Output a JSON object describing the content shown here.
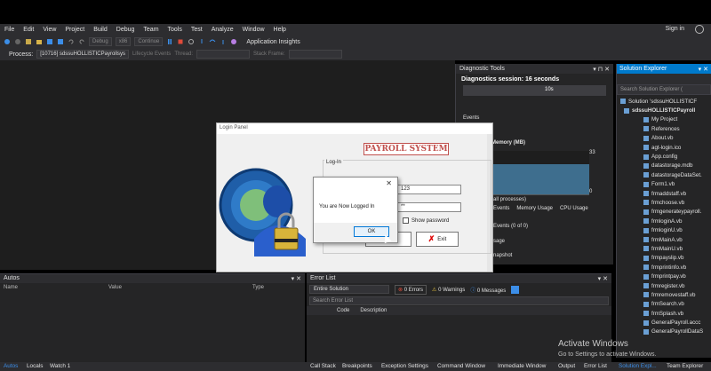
{
  "menu": [
    "File",
    "Edit",
    "View",
    "Project",
    "Build",
    "Debug",
    "Team",
    "Tools",
    "Test",
    "Analyze",
    "Window",
    "Help"
  ],
  "sign_in": "Sign in",
  "toolbar": {
    "config": "Debug",
    "platform": "x86",
    "continue": "Continue",
    "app_insights": "Application Insights"
  },
  "procbar": {
    "label": "Process:",
    "process": "[10716] sdssuHOLLISTICPayrollsys",
    "lifecycle": "Lifecycle Events",
    "thread": "Thread:",
    "stack": "Stack Frame:"
  },
  "diag": {
    "title": "Diagnostic Tools",
    "session": "Diagnostics session: 16 seconds",
    "timeline_label": "10s",
    "events": "Events",
    "memory": "Memory (MB)",
    "max": "33",
    "min": "0",
    "all_processes": "all processes)",
    "tabs": [
      "Events",
      "Memory Usage",
      "CPU Usage"
    ],
    "events_count": "Events (0 of 0)",
    "usage": "sage",
    "snapshot": "napshot"
  },
  "solution_explorer": {
    "title": "Solution Explorer",
    "search": "Search Solution Explorer (",
    "items": [
      {
        "label": "Solution 'sdssuHOLLISTICF",
        "bold": false
      },
      {
        "label": "sdssuHOLLISTICPayroll",
        "bold": true
      },
      {
        "label": "My Project",
        "bold": false
      },
      {
        "label": "References",
        "bold": false
      },
      {
        "label": "About.vb",
        "bold": false
      },
      {
        "label": "agt-login.ico",
        "bold": false
      },
      {
        "label": "App.config",
        "bold": false
      },
      {
        "label": "datastorage.mdb",
        "bold": false
      },
      {
        "label": "datastorageDataSet.",
        "bold": false
      },
      {
        "label": "Form1.vb",
        "bold": false
      },
      {
        "label": "frmaddstaff.vb",
        "bold": false
      },
      {
        "label": "frmchoose.vb",
        "bold": false
      },
      {
        "label": "frmgenerateypayroll.",
        "bold": false
      },
      {
        "label": "frmloginA.vb",
        "bold": false
      },
      {
        "label": "frmloginU.vb",
        "bold": false
      },
      {
        "label": "frmMainA.vb",
        "bold": false
      },
      {
        "label": "frmMainU.vb",
        "bold": false
      },
      {
        "label": "frmpayslip.vb",
        "bold": false
      },
      {
        "label": "frmprintinfo.vb",
        "bold": false
      },
      {
        "label": "frmprintpay.vb",
        "bold": false
      },
      {
        "label": "frmregister.vb",
        "bold": false
      },
      {
        "label": "frmremovestaff.vb",
        "bold": false
      },
      {
        "label": "frmSearch.vb",
        "bold": false
      },
      {
        "label": "frmSplash.vb",
        "bold": false
      },
      {
        "label": "GeneralPayroll.accc",
        "bold": false
      },
      {
        "label": "GeneralPayrollDataS",
        "bold": false
      }
    ]
  },
  "autos": {
    "title": "Autos",
    "cols": [
      "Name",
      "Value",
      "Type"
    ]
  },
  "errors": {
    "title": "Error List",
    "scope": "Entire Solution",
    "errors": "0 Errors",
    "warnings": "0 Warnings",
    "messages": "0 Messages",
    "search": "Search Error List",
    "cols": [
      "Code",
      "Description"
    ]
  },
  "bottom_tabs_left": [
    "Autos",
    "Locals",
    "Watch 1"
  ],
  "bottom_tabs_right": [
    "Call Stack",
    "Breakpoints",
    "Exception Settings",
    "Command Window",
    "Immediate Window",
    "Output",
    "Error List",
    "Solution Expl...",
    "Team Explorer"
  ],
  "activate": {
    "line1": "Activate Windows",
    "line2": "Go to Settings to activate Windows."
  },
  "login": {
    "title": "Login Panel",
    "banner": "PAYROLL SYSTEM",
    "group": "Log-In",
    "username": "123",
    "password": "**",
    "show_password": "Show password",
    "exit": "Exit"
  },
  "msgbox": {
    "text": "You are Now Logged In",
    "ok": "OK"
  }
}
